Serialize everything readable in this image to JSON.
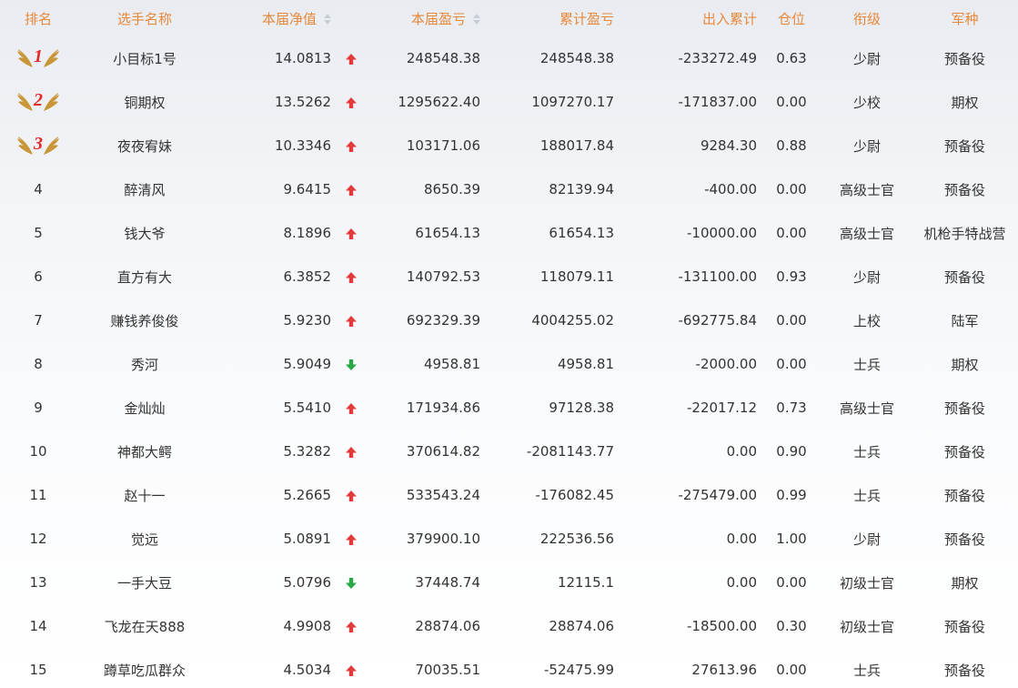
{
  "table": {
    "headers": {
      "rank": "排名",
      "name": "选手名称",
      "nav": "本届净值",
      "pl": "本届盈亏",
      "cum": "累计盈亏",
      "flow": "出入累计",
      "position": "仓位",
      "military_rank": "衔级",
      "arm": "军种"
    },
    "rows": [
      {
        "rank": "1",
        "name": "小目标1号",
        "nav": "14.0813",
        "trend": "up",
        "pl": "248548.38",
        "cum": "248548.38",
        "flow": "-233272.49",
        "position": "0.63",
        "military_rank": "少尉",
        "arm": "预备役"
      },
      {
        "rank": "2",
        "name": "铜期权",
        "nav": "13.5262",
        "trend": "up",
        "pl": "1295622.40",
        "cum": "1097270.17",
        "flow": "-171837.00",
        "position": "0.00",
        "military_rank": "少校",
        "arm": "期权"
      },
      {
        "rank": "3",
        "name": "夜夜宥妹",
        "nav": "10.3346",
        "trend": "up",
        "pl": "103171.06",
        "cum": "188017.84",
        "flow": "9284.30",
        "position": "0.88",
        "military_rank": "少尉",
        "arm": "预备役"
      },
      {
        "rank": "4",
        "name": "醉清风",
        "nav": "9.6415",
        "trend": "up",
        "pl": "8650.39",
        "cum": "82139.94",
        "flow": "-400.00",
        "position": "0.00",
        "military_rank": "高级士官",
        "arm": "预备役"
      },
      {
        "rank": "5",
        "name": "钱大爷",
        "nav": "8.1896",
        "trend": "up",
        "pl": "61654.13",
        "cum": "61654.13",
        "flow": "-10000.00",
        "position": "0.00",
        "military_rank": "高级士官",
        "arm": "机枪手特战营"
      },
      {
        "rank": "6",
        "name": "直方有大",
        "nav": "6.3852",
        "trend": "up",
        "pl": "140792.53",
        "cum": "118079.11",
        "flow": "-131100.00",
        "position": "0.93",
        "military_rank": "少尉",
        "arm": "预备役"
      },
      {
        "rank": "7",
        "name": "赚钱养俊俊",
        "nav": "5.9230",
        "trend": "up",
        "pl": "692329.39",
        "cum": "4004255.02",
        "flow": "-692775.84",
        "position": "0.00",
        "military_rank": "上校",
        "arm": "陆军"
      },
      {
        "rank": "8",
        "name": "秀河",
        "nav": "5.9049",
        "trend": "down",
        "pl": "4958.81",
        "cum": "4958.81",
        "flow": "-2000.00",
        "position": "0.00",
        "military_rank": "士兵",
        "arm": "期权"
      },
      {
        "rank": "9",
        "name": "金灿灿",
        "nav": "5.5410",
        "trend": "up",
        "pl": "171934.86",
        "cum": "97128.38",
        "flow": "-22017.12",
        "position": "0.73",
        "military_rank": "高级士官",
        "arm": "预备役"
      },
      {
        "rank": "10",
        "name": "神都大鳄",
        "nav": "5.3282",
        "trend": "up",
        "pl": "370614.82",
        "cum": "-2081143.77",
        "flow": "0.00",
        "position": "0.90",
        "military_rank": "士兵",
        "arm": "预备役"
      },
      {
        "rank": "11",
        "name": "赵十一",
        "nav": "5.2665",
        "trend": "up",
        "pl": "533543.24",
        "cum": "-176082.45",
        "flow": "-275479.00",
        "position": "0.99",
        "military_rank": "士兵",
        "arm": "预备役"
      },
      {
        "rank": "12",
        "name": "觉远",
        "nav": "5.0891",
        "trend": "up",
        "pl": "379900.10",
        "cum": "222536.56",
        "flow": "0.00",
        "position": "1.00",
        "military_rank": "少尉",
        "arm": "预备役"
      },
      {
        "rank": "13",
        "name": "一手大豆",
        "nav": "5.0796",
        "trend": "down",
        "pl": "37448.74",
        "cum": "12115.1",
        "flow": "0.00",
        "position": "0.00",
        "military_rank": "初级士官",
        "arm": "期权"
      },
      {
        "rank": "14",
        "name": "飞龙在天888",
        "nav": "4.9908",
        "trend": "up",
        "pl": "28874.06",
        "cum": "28874.06",
        "flow": "-18500.00",
        "position": "0.30",
        "military_rank": "初级士官",
        "arm": "预备役"
      },
      {
        "rank": "15",
        "name": "蹲草吃瓜群众",
        "nav": "4.5034",
        "trend": "up",
        "pl": "70035.51",
        "cum": "-52475.99",
        "flow": "27613.96",
        "position": "0.00",
        "military_rank": "士兵",
        "arm": "预备役"
      }
    ]
  },
  "colors": {
    "header_text": "#e8883a",
    "body_text": "#333333",
    "trend_up": "#e23b3b",
    "trend_down": "#27a844",
    "medal_gold": "#c9963a",
    "medal_number": "#e02a2a"
  },
  "icons": {
    "sort": "sort-icon",
    "trend_up": "arrow-up-icon",
    "trend_down": "arrow-down-icon",
    "medal": "winged-medal-icon"
  }
}
